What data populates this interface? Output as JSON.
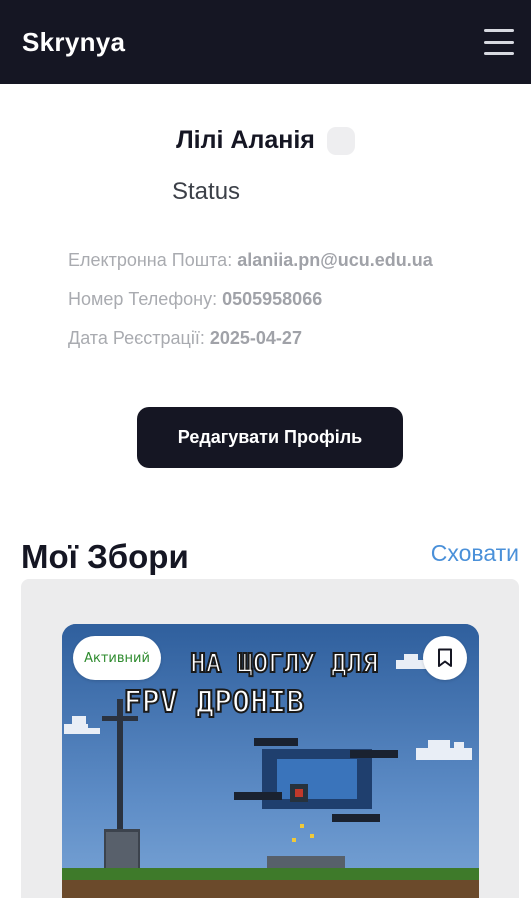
{
  "header": {
    "brand": "Skrynya",
    "menu_icon": "hamburger-menu-icon"
  },
  "profile": {
    "name": "Лілі Аланія",
    "status": "Status",
    "email_label": "Електронна Пошта:",
    "email": "alaniia.pn@ucu.edu.ua",
    "phone_label": "Номер Телефону:",
    "phone": "0505958066",
    "date_label": "Дата Реєстрації:",
    "date": "2025-04-27",
    "edit_button": "Редагувати Профіль"
  },
  "collections": {
    "title": "Мої Збори",
    "hide_link": "Сховати",
    "cards": [
      {
        "badge": "Активний",
        "badge_color": "#2e8b2e",
        "image_line1": "НА ЩОГЛУ ДЛЯ",
        "image_line2": "FPV ДРОНІВ",
        "bookmark_icon": "bookmark-icon"
      }
    ]
  },
  "colors": {
    "dark": "#151623",
    "link": "#4a90d9",
    "panel": "#ececed"
  }
}
